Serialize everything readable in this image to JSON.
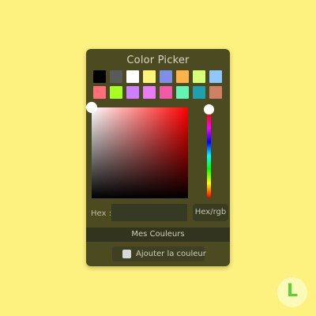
{
  "picker": {
    "title": "Color Picker",
    "swatches": [
      "#000000",
      "#5a5a5a",
      "#ffffff",
      "#fff47a",
      "#7d8fe8",
      "#ffb14a",
      "#d4ff76",
      "#8fc8ff",
      "#ff6e79",
      "#a6ff1f",
      "#ce7dff",
      "#ea7df7",
      "#f25aa8",
      "#62f5b1",
      "#1fa1ad",
      "#d08066"
    ],
    "hex_label": "Hex :",
    "hex_value": "",
    "format_button": "Hex/rgb",
    "my_colors": "Mes Couleurs",
    "add_color_button": "Ajouter la couleur"
  },
  "logo": {
    "letter": "L",
    "icon": "brand-logo-icon"
  },
  "colors": {
    "background": "#fdf17f",
    "panel": "#4c4a20",
    "logo_accent": "#5ccf3b"
  }
}
